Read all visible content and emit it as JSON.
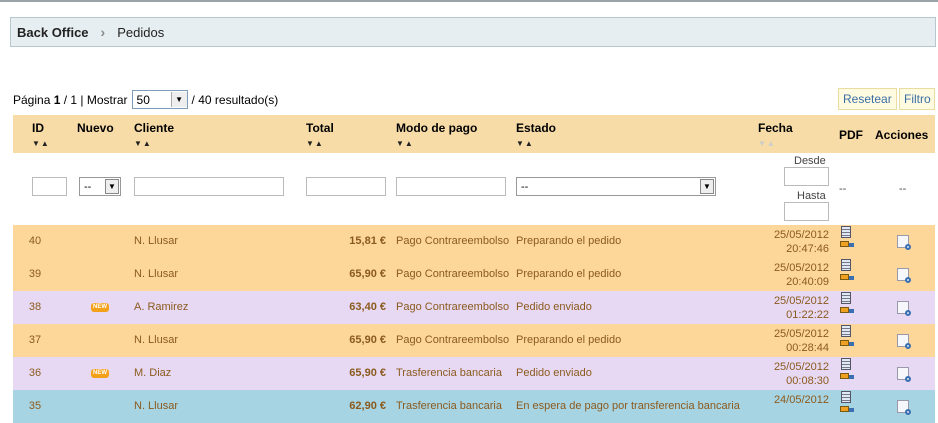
{
  "breadcrumb": {
    "home": "Back Office",
    "current": "Pedidos"
  },
  "pager": {
    "page_label": "Página",
    "page": "1",
    "of": "/ 1 | Mostrar",
    "per_page": "50",
    "results": "/ 40 resultado(s)"
  },
  "buttons": {
    "reset": "Resetear",
    "filter": "Filtro"
  },
  "columns": {
    "id": "ID",
    "new": "Nuevo",
    "client": "Cliente",
    "total": "Total",
    "payment": "Modo de pago",
    "status": "Estado",
    "date": "Fecha",
    "pdf": "PDF",
    "actions": "Acciones"
  },
  "filters": {
    "new_value": "--",
    "status_value": "--",
    "from_label": "Desde",
    "to_label": "Hasta",
    "pdf_dash": "--",
    "actions_dash": "--"
  },
  "colors": {
    "orange": "#fdd79a",
    "purple": "#e7d9f3",
    "blue": "#a7d4e2",
    "header": "#f8dca8",
    "link": "#3a6ea5"
  },
  "rows": [
    {
      "id": "40",
      "new": "",
      "client": "N. Llusar",
      "total": "15,81 €",
      "payment": "Pago Contrareembolso",
      "status": "Preparando el pedido",
      "date": "25/05/2012",
      "time": "20:47:46",
      "color": "orange"
    },
    {
      "id": "39",
      "new": "",
      "client": "N. Llusar",
      "total": "65,90 €",
      "payment": "Pago Contrareembolso",
      "status": "Preparando el pedido",
      "date": "25/05/2012",
      "time": "20:40:09",
      "color": "orange"
    },
    {
      "id": "38",
      "new": "NEW",
      "client": "A. Ramirez",
      "total": "63,40 €",
      "payment": "Pago Contrareembolso",
      "status": "Pedido enviado",
      "date": "25/05/2012",
      "time": "01:22:22",
      "color": "purple"
    },
    {
      "id": "37",
      "new": "",
      "client": "N. Llusar",
      "total": "65,90 €",
      "payment": "Pago Contrareembolso",
      "status": "Preparando el pedido",
      "date": "25/05/2012",
      "time": "00:28:44",
      "color": "orange"
    },
    {
      "id": "36",
      "new": "NEW",
      "client": "M. Diaz",
      "total": "65,90 €",
      "payment": "Trasferencia bancaria",
      "status": "Pedido enviado",
      "date": "25/05/2012",
      "time": "00:08:30",
      "color": "purple"
    },
    {
      "id": "35",
      "new": "",
      "client": "N. Llusar",
      "total": "62,90 €",
      "payment": "Trasferencia bancaria",
      "status": "En espera de pago por transferencia bancaria",
      "date": "24/05/2012",
      "time": "",
      "color": "blue"
    }
  ]
}
